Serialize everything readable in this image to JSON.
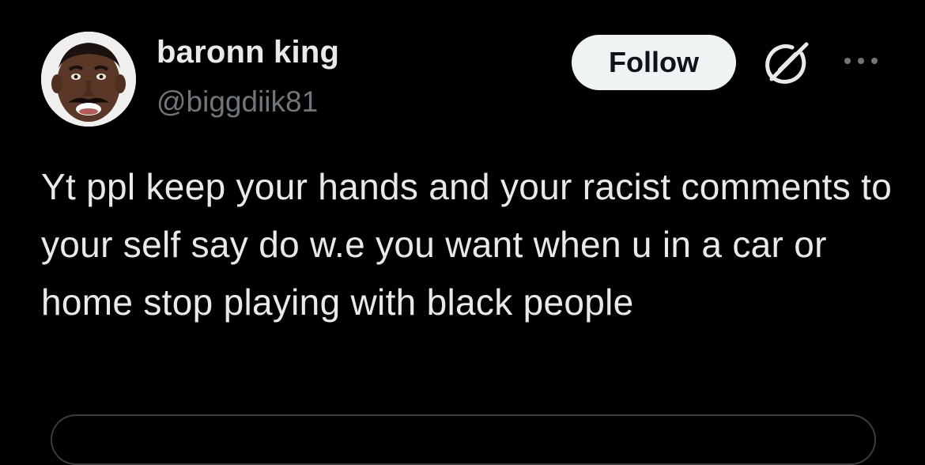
{
  "user": {
    "display_name": "baronn king",
    "handle": "@biggdiik81",
    "avatar": "avatar-photo"
  },
  "actions": {
    "follow_label": "Follow",
    "grok_icon": "grok-icon",
    "more_icon": "more-options-icon"
  },
  "tweet": {
    "text": "Yt ppl keep your hands and your racist comments to your self say do w.e you want when u in a car or home stop playing with black people"
  },
  "colors": {
    "background": "#000000",
    "primary_text": "#e7e9ea",
    "secondary_text": "#71767b",
    "follow_button_bg": "#eff3f4",
    "follow_button_text": "#0f1419"
  }
}
